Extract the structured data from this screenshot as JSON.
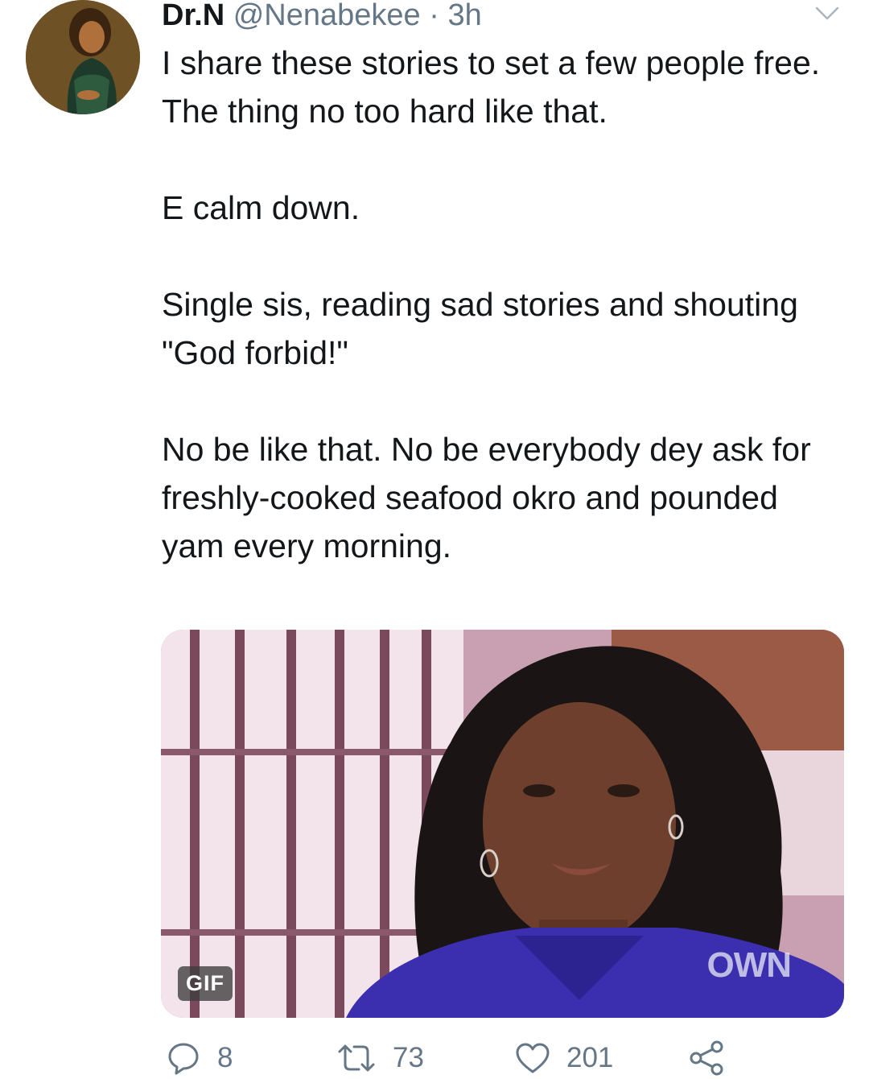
{
  "tweet": {
    "author_name": "Dr.N",
    "handle": "@Nenabekee",
    "separator": "·",
    "time": "3h",
    "text": "I share these stories to set a few people free.\nThe thing no too hard like that.\n\nE calm down.\n\nSingle sis, reading sad stories and shouting \"God forbid!\"\n\nNo be like that. No be everybody dey ask for freshly-cooked seafood okro and pounded yam every morning.",
    "media": {
      "badge": "GIF",
      "watermark": "OWN"
    },
    "actions": {
      "reply_count": "8",
      "retweet_count": "73",
      "like_count": "201"
    }
  },
  "icons": {
    "caret": "chevron-down-icon",
    "reply": "reply-icon",
    "retweet": "retweet-icon",
    "like": "heart-icon",
    "share": "share-icon"
  },
  "colors": {
    "text": "#14171a",
    "secondary": "#657786"
  }
}
